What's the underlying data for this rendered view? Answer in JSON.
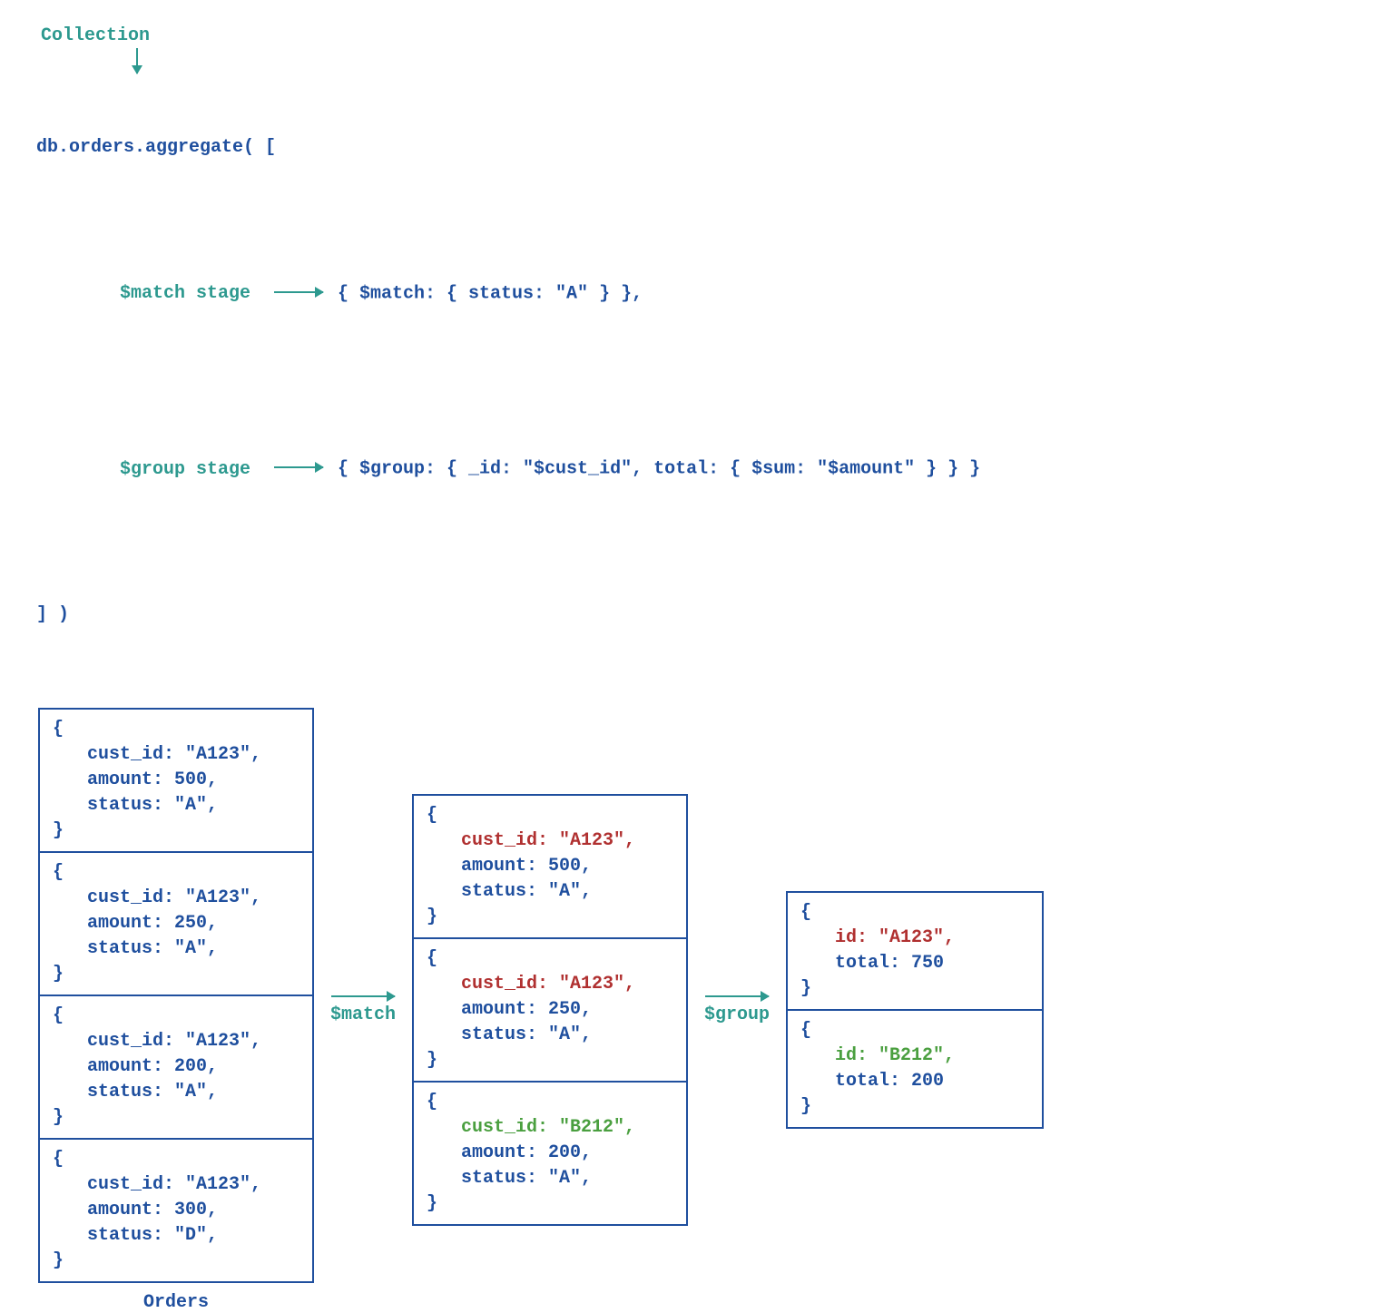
{
  "labels": {
    "collection": "Collection",
    "aggregate_call": "db.orders.aggregate( [",
    "match_stage_label": "$match stage",
    "group_stage_label": "$group stage",
    "match_code": "{ $match: { status: \"A\" } },",
    "group_code": "{ $group: { _id: \"$cust_id\", total: { $sum: \"$amount\" } } }",
    "close": "] )",
    "orders_caption": "Orders",
    "match_arrow": "$match",
    "group_arrow": "$group"
  },
  "orders": [
    {
      "cust": "cust_id: \"A123\",",
      "amount": "amount: 500,",
      "status": "status: \"A\","
    },
    {
      "cust": "cust_id: \"A123\",",
      "amount": "amount: 250,",
      "status": "status: \"A\","
    },
    {
      "cust": "cust_id: \"A123\",",
      "amount": "amount: 200,",
      "status": "status: \"A\","
    },
    {
      "cust": "cust_id: \"A123\",",
      "amount": "amount: 300,",
      "status": "status: \"D\","
    }
  ],
  "matched": [
    {
      "cust": "cust_id: \"A123\",",
      "amount": "amount: 500,",
      "status": "status: \"A\",",
      "cust_class": "red"
    },
    {
      "cust": "cust_id: \"A123\",",
      "amount": "amount: 250,",
      "status": "status: \"A\",",
      "cust_class": "red"
    },
    {
      "cust": "cust_id: \"B212\",",
      "amount": "amount: 200,",
      "status": "status: \"A\",",
      "cust_class": "green"
    }
  ],
  "grouped": [
    {
      "id": "id: \"A123\",",
      "total": "total: 750",
      "id_class": "red"
    },
    {
      "id": "id: \"B212\",",
      "total": "total: 200",
      "id_class": "green"
    }
  ]
}
